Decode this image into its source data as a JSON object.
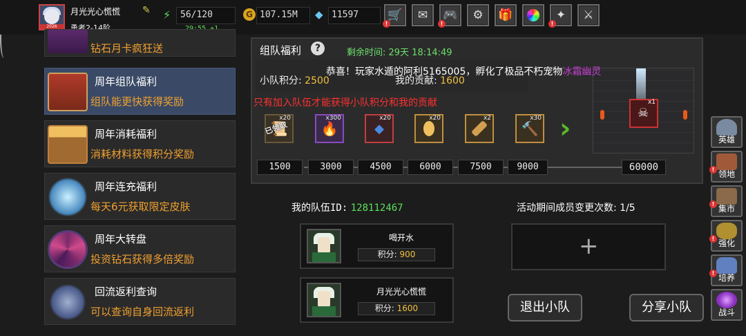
{
  "player": {
    "name": "月光光心慌慌",
    "rank": "勇者2-14阶",
    "avatar_badge": "2026"
  },
  "stats": {
    "energy": "56/120",
    "energy_timer": "29:55 +1",
    "gold": "107.15M",
    "gems": "11597"
  },
  "toolbar": {
    "icons": [
      "cart-icon",
      "mail-icon",
      "gamepad-icon",
      "gear-icon",
      "gift-icon",
      "color-wheel-icon",
      "wand-icon",
      "crossed-swords-icon"
    ]
  },
  "menu": {
    "items": [
      {
        "title": "",
        "subtitle": "钻石月卡疯狂送"
      },
      {
        "title": "周年组队福利",
        "subtitle": "组队能更快获得奖励"
      },
      {
        "title": "周年消耗福利",
        "subtitle": "消耗材料获得积分奖励"
      },
      {
        "title": "周年连充福利",
        "subtitle": "每天6元获取限定皮肤"
      },
      {
        "title": "周年大转盘",
        "subtitle": "投资钻石获得多倍奖励"
      },
      {
        "title": "回流返利查询",
        "subtitle": "可以查询自身回流返利"
      }
    ]
  },
  "panel": {
    "title": "组队福利",
    "remaining": "剩余时间: 29天 18:14:49",
    "notice": "恭喜！玩家水遁的阿利5165005，孵化了极品不朽宠物",
    "notice_pet": "冰霜幽灵",
    "score_label": "小队积分:",
    "score_value": "2500",
    "contrib_label": "我的贡献:",
    "contrib_value": "1600",
    "warning": "只有加入队伍才能获得小队积分和我的贡献",
    "rewards": [
      {
        "count": "x20",
        "claimed": "已领取"
      },
      {
        "count": "x300"
      },
      {
        "count": "x20"
      },
      {
        "count": "x20"
      },
      {
        "count": "x2"
      },
      {
        "count": "x30"
      }
    ],
    "milestones": [
      "1500",
      "3000",
      "4500",
      "6000",
      "7500",
      "9000",
      "60000"
    ],
    "big_reward_count": "x1"
  },
  "team": {
    "id_label": "我的队伍ID:",
    "id_value": "128112467",
    "changes_label": "活动期间成员变更次数:",
    "changes_value": "1/5",
    "members": [
      {
        "name": "喝开水",
        "score_label": "积分:",
        "score": "900"
      },
      {
        "name": "月光光心慌慌",
        "score_label": "积分:",
        "score": "1600"
      }
    ],
    "empty_slot": "+",
    "leave_button": "退出小队",
    "share_button": "分享小队"
  },
  "rightbar": {
    "items": [
      {
        "label": "英雄",
        "icon": "helmet-icon",
        "color": "#7a8aa0",
        "alert": false
      },
      {
        "label": "领地",
        "icon": "castle-icon",
        "color": "#a05a3a",
        "alert": true
      },
      {
        "label": "集市",
        "icon": "market-icon",
        "color": "#8a6a4a",
        "alert": true
      },
      {
        "label": "强化",
        "icon": "crystal-icon",
        "color": "#b09030",
        "alert": true
      },
      {
        "label": "培养",
        "icon": "trophy-icon",
        "color": "#6080c0",
        "alert": true
      },
      {
        "label": "战斗",
        "icon": "portal-icon",
        "color": "#8a30c0",
        "alert": false
      }
    ]
  }
}
